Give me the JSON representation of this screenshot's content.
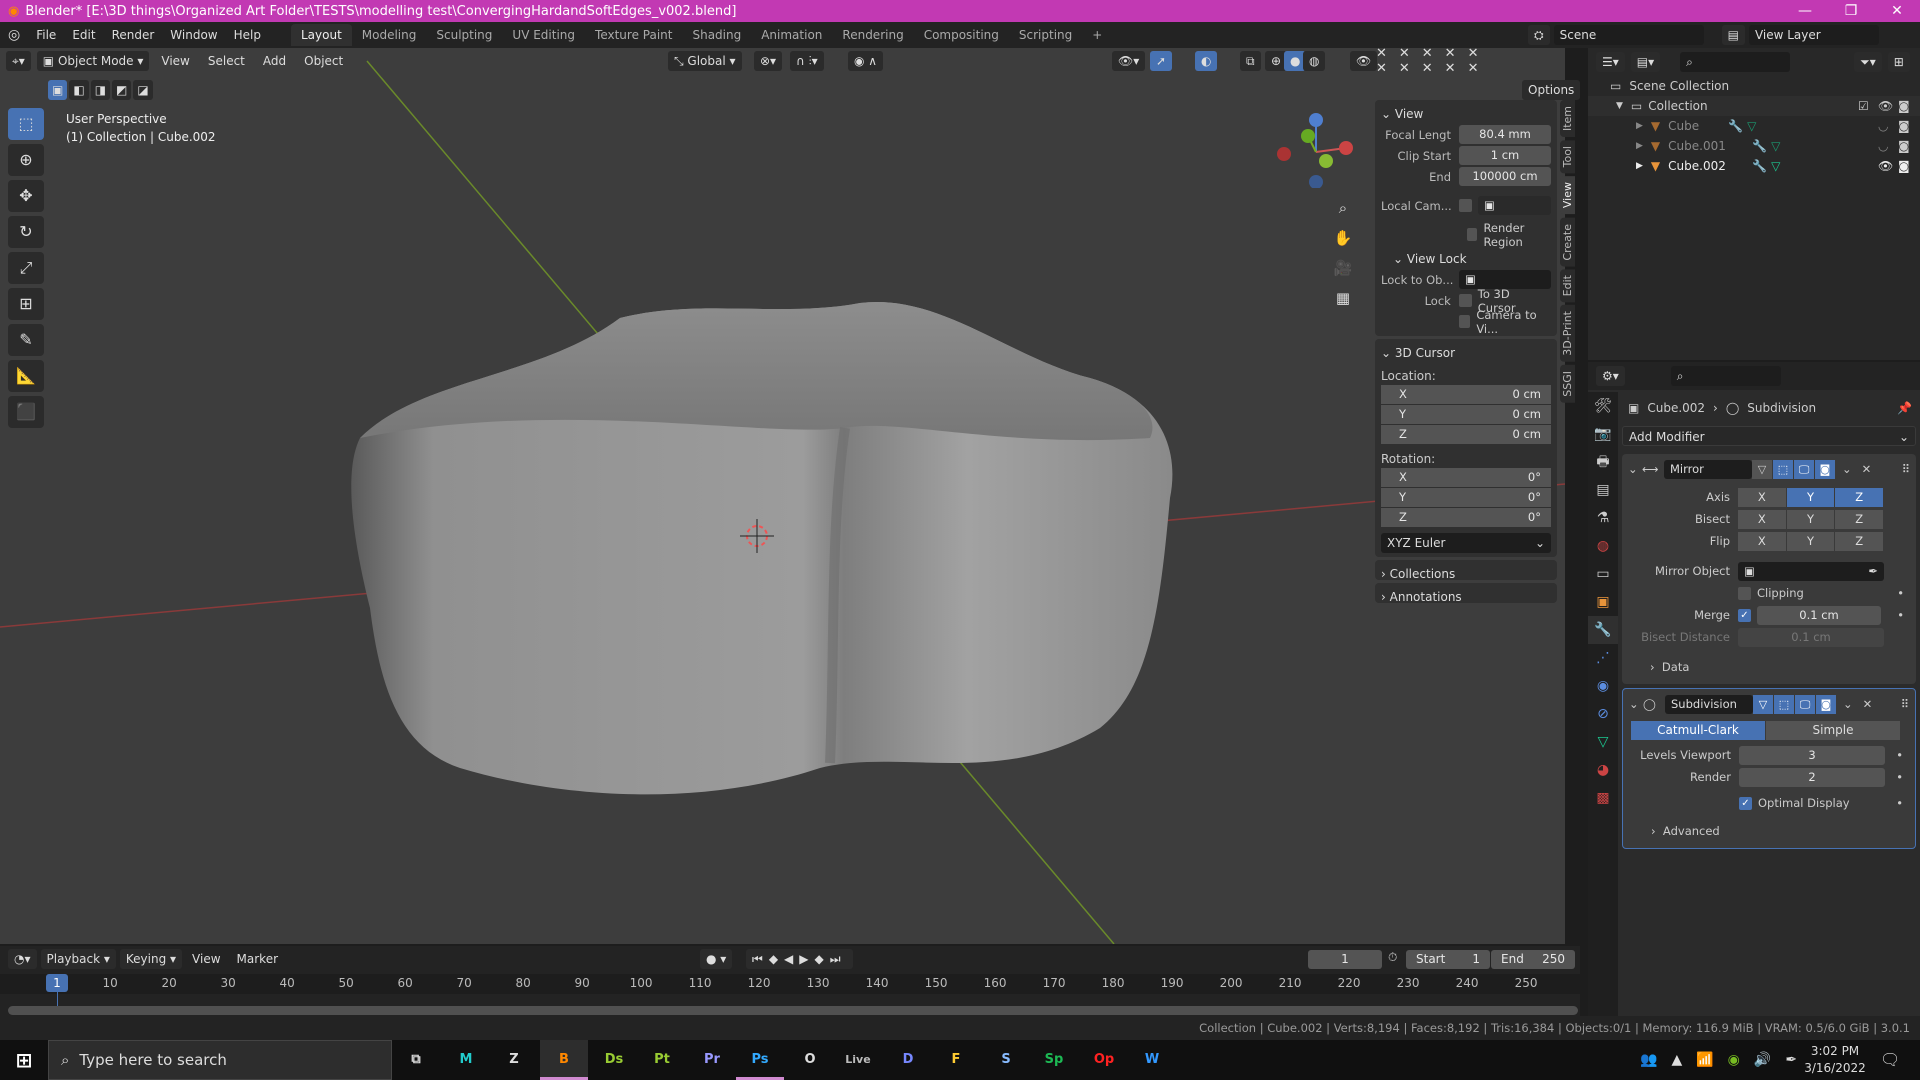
{
  "window": {
    "title": "Blender* [E:\\3D things\\Organized Art Folder\\TESTS\\modelling test\\ConvergingHardandSoftEdges_v002.blend]",
    "accent": "#c239b3"
  },
  "menu": [
    "File",
    "Edit",
    "Render",
    "Window",
    "Help"
  ],
  "workspaces": [
    "Layout",
    "Modeling",
    "Sculpting",
    "UV Editing",
    "Texture Paint",
    "Shading",
    "Animation",
    "Rendering",
    "Compositing",
    "Scripting",
    "+"
  ],
  "scene": {
    "name": "Scene",
    "view_layer": "View Layer"
  },
  "viewport_header": {
    "mode": "Object Mode",
    "menus": [
      "View",
      "Select",
      "Add",
      "Object"
    ],
    "orientation": "Global",
    "options": "Options"
  },
  "viewport": {
    "view_name": "User Perspective",
    "collection_info": "(1) Collection | Cube.002"
  },
  "tools": [
    "select-box",
    "cursor",
    "move",
    "rotate",
    "scale",
    "transform",
    "annotate",
    "measure",
    "add-cube"
  ],
  "npanel": {
    "tabs": [
      "Item",
      "Tool",
      "View",
      "Create",
      "Edit",
      "3D-Print",
      "SSGI"
    ],
    "active_tab": "View",
    "view": {
      "title": "View",
      "focal_label": "Focal Lengt",
      "focal": "80.4 mm",
      "clip_start_label": "Clip Start",
      "clip_start": "1 cm",
      "end_label": "End",
      "end": "100000 cm",
      "local_cam_label": "Local Cam...",
      "render_region": "Render Region"
    },
    "view_lock": {
      "title": "View Lock",
      "lock_to_label": "Lock to Ob...",
      "lock_label": "Lock",
      "to_cursor": "To 3D Cursor",
      "camera_to_view": "Camera to Vi..."
    },
    "cursor": {
      "title": "3D Cursor",
      "location_label": "Location:",
      "location": [
        {
          "axis": "X",
          "value": "0 cm"
        },
        {
          "axis": "Y",
          "value": "0 cm"
        },
        {
          "axis": "Z",
          "value": "0 cm"
        }
      ],
      "rotation_label": "Rotation:",
      "rotation": [
        {
          "axis": "X",
          "value": "0°"
        },
        {
          "axis": "Y",
          "value": "0°"
        },
        {
          "axis": "Z",
          "value": "0°"
        }
      ],
      "rotation_mode": "XYZ Euler"
    },
    "collections": "Collections",
    "annotations": "Annotations"
  },
  "outliner": {
    "root": "Scene Collection",
    "collection": "Collection",
    "objects": [
      {
        "name": "Cube",
        "visible": false
      },
      {
        "name": "Cube.001",
        "visible": false
      },
      {
        "name": "Cube.002",
        "visible": true
      }
    ]
  },
  "properties": {
    "breadcrumb_object": "Cube.002",
    "breadcrumb_modifier": "Subdivision",
    "add_modifier": "Add Modifier",
    "mirror": {
      "name": "Mirror",
      "axis_label": "Axis",
      "bisect_label": "Bisect",
      "flip_label": "Flip",
      "axes": [
        "X",
        "Y",
        "Z"
      ],
      "axis_on": [
        false,
        true,
        true
      ],
      "mirror_object_label": "Mirror Object",
      "clipping": "Clipping",
      "merge_label": "Merge",
      "merge": "0.1 cm",
      "merge_on": true,
      "bisect_distance_label": "Bisect Distance",
      "bisect_distance": "0.1 cm",
      "data": "Data"
    },
    "subdivision": {
      "name": "Subdivision",
      "catmull": "Catmull-Clark",
      "simple": "Simple",
      "levels_label": "Levels Viewport",
      "levels": "3",
      "render_label": "Render",
      "render": "2",
      "optimal": "Optimal Display",
      "optimal_on": true,
      "advanced": "Advanced"
    }
  },
  "timeline": {
    "menus": [
      "Playback",
      "Keying",
      "View",
      "Marker"
    ],
    "current_frame": "1",
    "start_label": "Start",
    "start": "1",
    "end_label": "End",
    "end": "250",
    "ticks": [
      "10",
      "20",
      "30",
      "40",
      "50",
      "60",
      "70",
      "80",
      "90",
      "100",
      "110",
      "120",
      "130",
      "140",
      "150",
      "160",
      "170",
      "180",
      "190",
      "200",
      "210",
      "220",
      "230",
      "240",
      "250"
    ]
  },
  "statusbar": "Collection | Cube.002 | Verts:8,194 | Faces:8,192 | Tris:16,384 | Objects:0/1 | Memory: 116.9 MiB | VRAM: 0.5/6.0 GiB | 3.0.1",
  "taskbar": {
    "search_placeholder": "Type here to search",
    "apps": [
      "M",
      "Z",
      "B",
      "Ds",
      "Pt",
      "Pr",
      "Ps",
      "O",
      "Live",
      "D",
      "F",
      "S",
      "Sp",
      "Op",
      "W"
    ],
    "time": "3:02 PM",
    "date": "3/16/2022"
  }
}
